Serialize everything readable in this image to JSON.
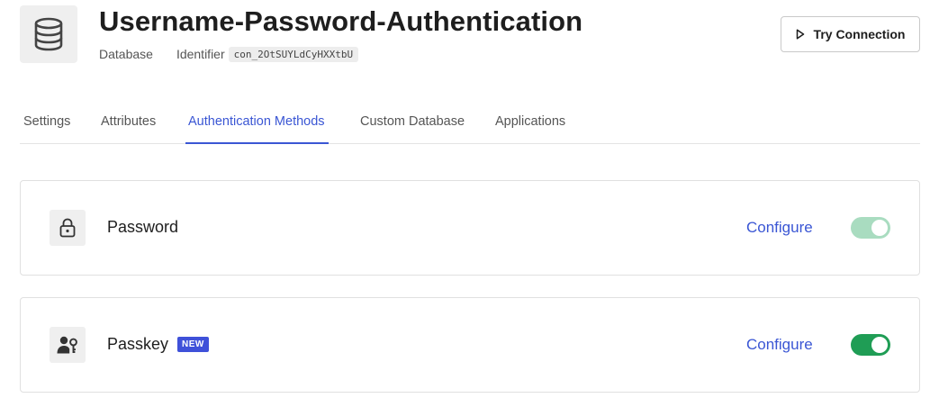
{
  "header": {
    "title": "Username-Password-Authentication",
    "type_label": "Database",
    "identifier_label": "Identifier",
    "identifier_value": "con_2OtSUYLdCyHXXtbU",
    "icon": "database-icon",
    "try_connection_label": "Try Connection",
    "try_connection_icon": "play-icon"
  },
  "tabs": [
    {
      "label": "Settings",
      "active": false
    },
    {
      "label": "Attributes",
      "active": false
    },
    {
      "label": "Authentication Methods",
      "active": true
    },
    {
      "label": "Custom Database",
      "active": false
    },
    {
      "label": "Applications",
      "active": false
    }
  ],
  "methods": [
    {
      "name": "Password",
      "icon": "lock-icon",
      "configure_label": "Configure",
      "enabled": true,
      "toggle_color": "#a9dcc0"
    },
    {
      "name": "Passkey",
      "icon": "user-key-icon",
      "badge": "NEW",
      "configure_label": "Configure",
      "enabled": true,
      "toggle_color": "#1f9d55"
    }
  ],
  "colors": {
    "accent": "#3a56d4",
    "badge": "#3f51d9",
    "toggle_on": "#1f9d55"
  }
}
